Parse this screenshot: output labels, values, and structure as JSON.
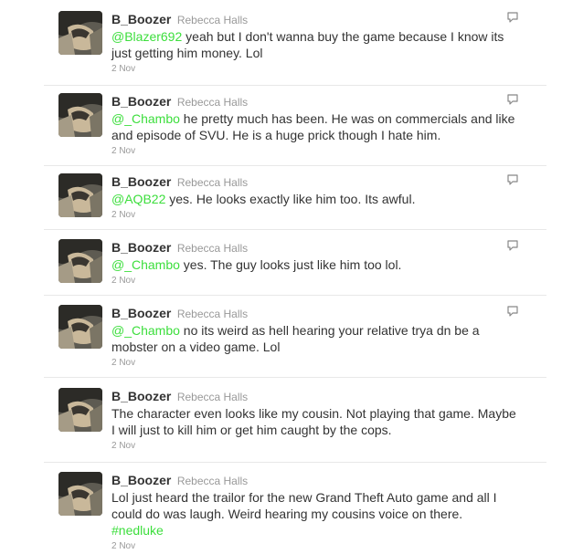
{
  "tweets": [
    {
      "screen_name": "B_Boozer",
      "full_name": "Rebecca Halls",
      "mention": "@Blazer692",
      "text": " yeah but I don't wanna buy the game because I know its just getting him money. Lol",
      "hashtag": "",
      "timestamp": "2 Nov"
    },
    {
      "screen_name": "B_Boozer",
      "full_name": "Rebecca Halls",
      "mention": "@_Chambo",
      "text": " he pretty much has been. He was on commercials and like and episode of SVU. He is a huge prick though I hate him.",
      "hashtag": "",
      "timestamp": "2 Nov"
    },
    {
      "screen_name": "B_Boozer",
      "full_name": "Rebecca Halls",
      "mention": "@AQB22",
      "text": " yes. He looks exactly like him too. Its awful.",
      "hashtag": "",
      "timestamp": "2 Nov"
    },
    {
      "screen_name": "B_Boozer",
      "full_name": "Rebecca Halls",
      "mention": "@_Chambo",
      "text": " yes. The guy looks just like him too lol.",
      "hashtag": "",
      "timestamp": "2 Nov"
    },
    {
      "screen_name": "B_Boozer",
      "full_name": "Rebecca Halls",
      "mention": "@_Chambo",
      "text": " no its weird as hell hearing your relative trya dn be a mobster on a video game. Lol",
      "hashtag": "",
      "timestamp": "2 Nov"
    },
    {
      "screen_name": "B_Boozer",
      "full_name": "Rebecca Halls",
      "mention": "",
      "text": "The character even looks like my cousin. Not playing that game. Maybe I will just to kill him or get him caught by the cops.",
      "hashtag": "",
      "timestamp": "2 Nov"
    },
    {
      "screen_name": "B_Boozer",
      "full_name": "Rebecca Halls",
      "mention": "",
      "text": "Lol just heard the trailor for the new Grand Theft Auto game and all I could do was laugh. Weird hearing my cousins voice on there.",
      "hashtag": "#nedluke",
      "timestamp": "2 Nov"
    }
  ],
  "icons": {
    "reply": "speech-bubble-icon",
    "avatar": "profile-photo"
  },
  "colors": {
    "link": "#3cde3c",
    "name": "#333333",
    "meta": "#999999",
    "divider": "#e8e8e8"
  }
}
